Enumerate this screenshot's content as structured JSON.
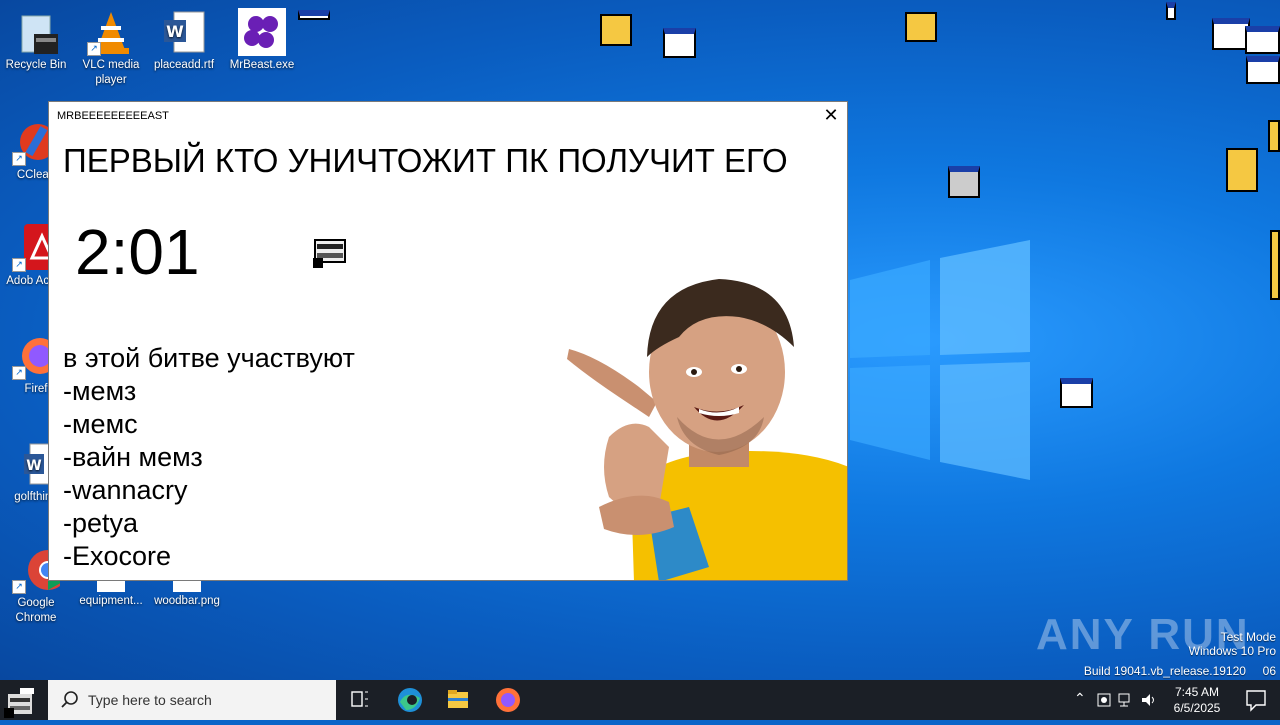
{
  "desktop": {
    "icons": [
      {
        "label": "Recycle Bin"
      },
      {
        "label": "VLC media player"
      },
      {
        "label": "placeadd.rtf"
      },
      {
        "label": "MrBeast.exe"
      },
      {
        "label": "CClean"
      },
      {
        "label": "Adob Acrob"
      },
      {
        "label": "Firef"
      },
      {
        "label": "golfthing"
      },
      {
        "label": "Google Chrome"
      },
      {
        "label": "equipment..."
      },
      {
        "label": "woodbar.png"
      }
    ],
    "watermark": {
      "line1": "Test Mode",
      "line2": "Windows 10 Pro",
      "line3": "Build 19041.vb_release.19120",
      "line3_tail": "06"
    },
    "anyrun": "ANY RUN"
  },
  "dialog": {
    "title": "MRBEEEEEEEEEAST",
    "close_glyph": "✕",
    "headline": "ПЕРВЫЙ КТО УНИЧТОЖИТ ПК ПОЛУЧИТ ЕГО",
    "timer": "2:01",
    "participants_heading": "в этой битве участвуют",
    "participants": [
      "-мемз",
      "-мемс",
      "-вайн мемз",
      "-wannacry",
      "-petya",
      "-Exocore"
    ]
  },
  "taskbar": {
    "search_placeholder": "Type here to search",
    "clock_time": "7:45 AM",
    "clock_date": "6/5/2025"
  },
  "colors": {
    "taskbar": "#1b1f26",
    "wallpaper": "#0f78e0",
    "accent": "#1a3fa8"
  }
}
